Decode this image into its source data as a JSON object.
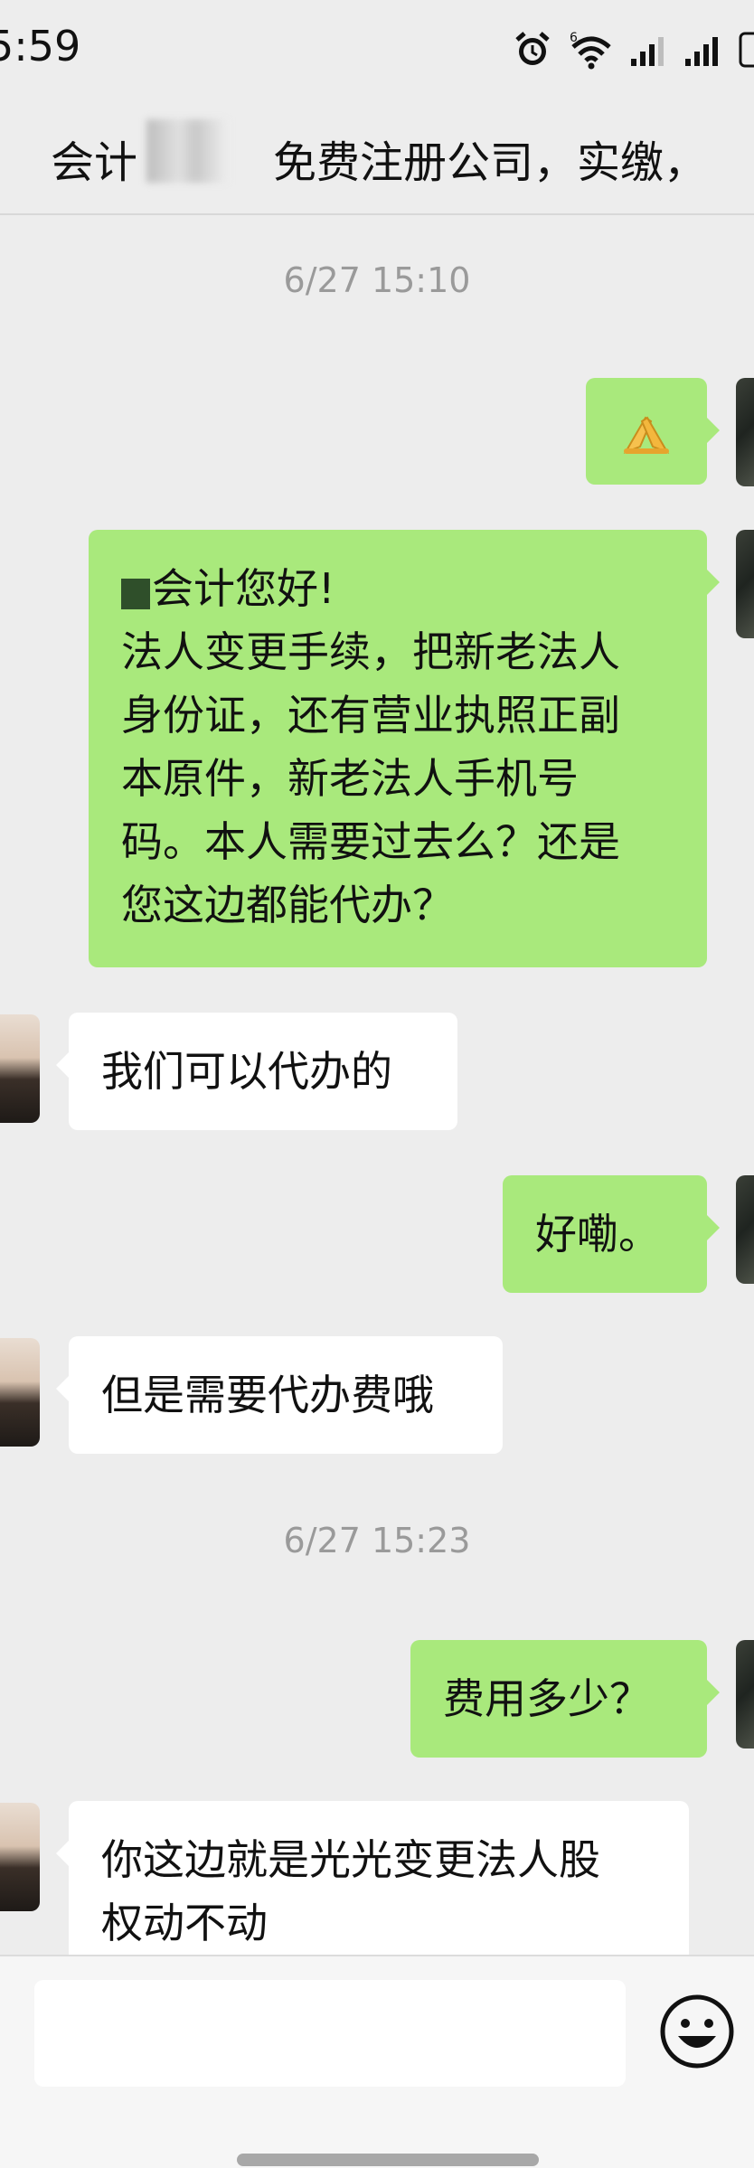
{
  "status_bar": {
    "time": "5:59",
    "icons": [
      "alarm-icon",
      "wifi-icon",
      "signal-icon",
      "signal-icon",
      "battery-icon"
    ]
  },
  "header": {
    "title_part1": "会计",
    "title_part2": "免费注册公司，实缴，"
  },
  "timestamps": [
    "6/27 15:10",
    "6/27 15:23"
  ],
  "messages": [
    {
      "side": "out",
      "text": "🙏"
    },
    {
      "side": "out",
      "text": "会计您好!\n法人变更手续，把新老法人\n身份证，还有营业执照正副\n本原件，新老法人手机号\n码。本人需要过去么？还是\n您这边都能代办？"
    },
    {
      "side": "in",
      "text": "我们可以代办的"
    },
    {
      "side": "out",
      "text": "好嘞。"
    },
    {
      "side": "in",
      "text": "但是需要代办费哦"
    },
    {
      "side": "out",
      "text": "费用多少？"
    },
    {
      "side": "in",
      "text": "你这边就是光光变更法人股\n权动不动"
    }
  ],
  "input_bar": {
    "input_value": "",
    "emoji_button": "emoji-icon"
  },
  "colors": {
    "background": "#ededed",
    "outgoing_bubble": "#a9e97c",
    "incoming_bubble": "#ffffff",
    "timestamp_text": "#9a9a9a"
  }
}
